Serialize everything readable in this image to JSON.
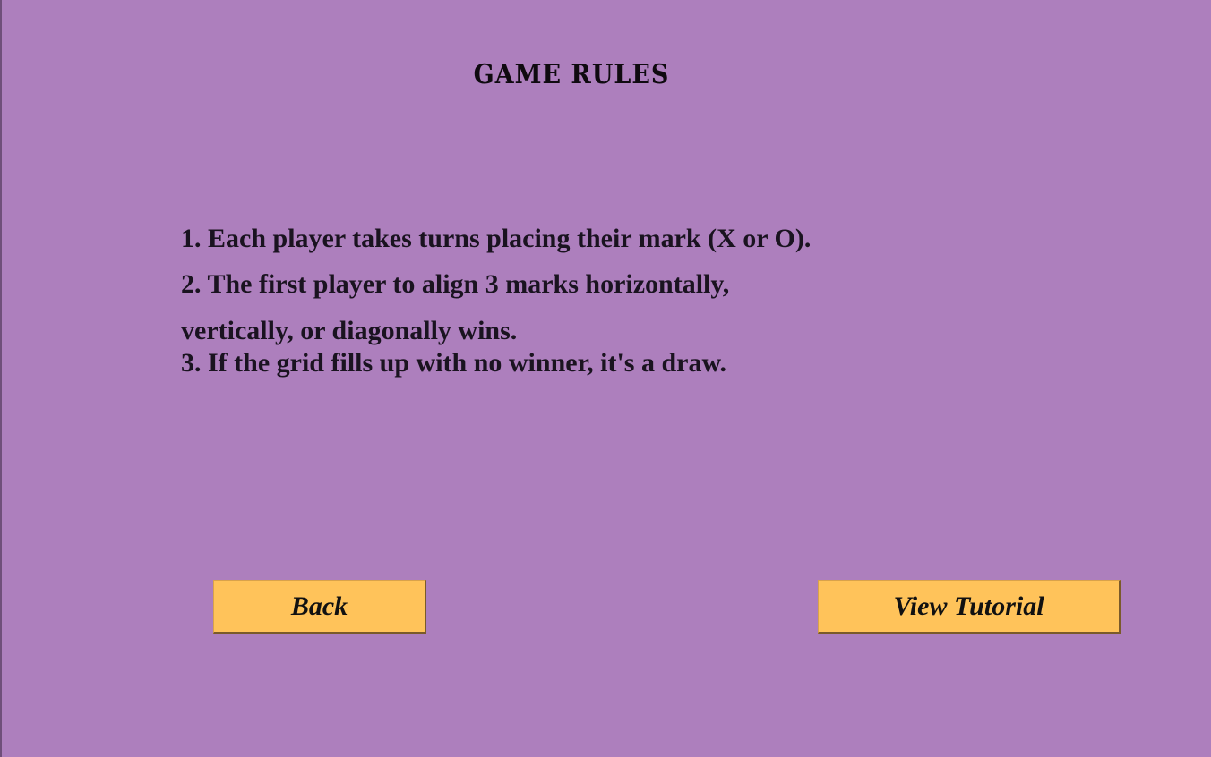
{
  "screen": {
    "title": "Game Rules"
  },
  "rules": {
    "line1": "1. Each player takes turns placing their mark (X or O).",
    "line2a": "2. The first player to align 3 marks horizontally,",
    "line2b": "vertically, or diagonally wins.",
    "line3": "3. If the grid fills up with no winner, it's a draw."
  },
  "buttons": {
    "back": "Back",
    "tutorial": "View Tutorial"
  },
  "colors": {
    "background": "#ad7fbd",
    "button": "#ffc35a",
    "text": "#111111"
  }
}
